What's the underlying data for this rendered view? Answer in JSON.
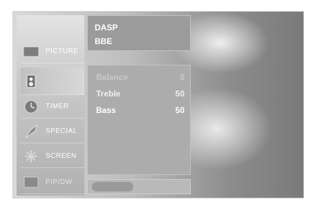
{
  "menu": {
    "items": [
      {
        "label": "PICTURE",
        "icon": "picture-icon"
      },
      {
        "label": "",
        "icon": "speaker-icon"
      },
      {
        "label": "TIMER",
        "icon": "timer-icon"
      },
      {
        "label": "SPECIAL",
        "icon": "special-icon"
      },
      {
        "label": "SCREEN",
        "icon": "screen-icon"
      },
      {
        "label": "PIP/DW",
        "icon": "pip-icon"
      }
    ]
  },
  "sound_menu": {
    "top_options": [
      "DASP",
      "BBE"
    ],
    "rows": [
      {
        "label": "Balance",
        "value": "0"
      },
      {
        "label": "Treble",
        "value": "50"
      },
      {
        "label": "Bass",
        "value": "50"
      }
    ]
  },
  "colors": {
    "panel": "#9b9b9b",
    "text": "#ffffff"
  }
}
